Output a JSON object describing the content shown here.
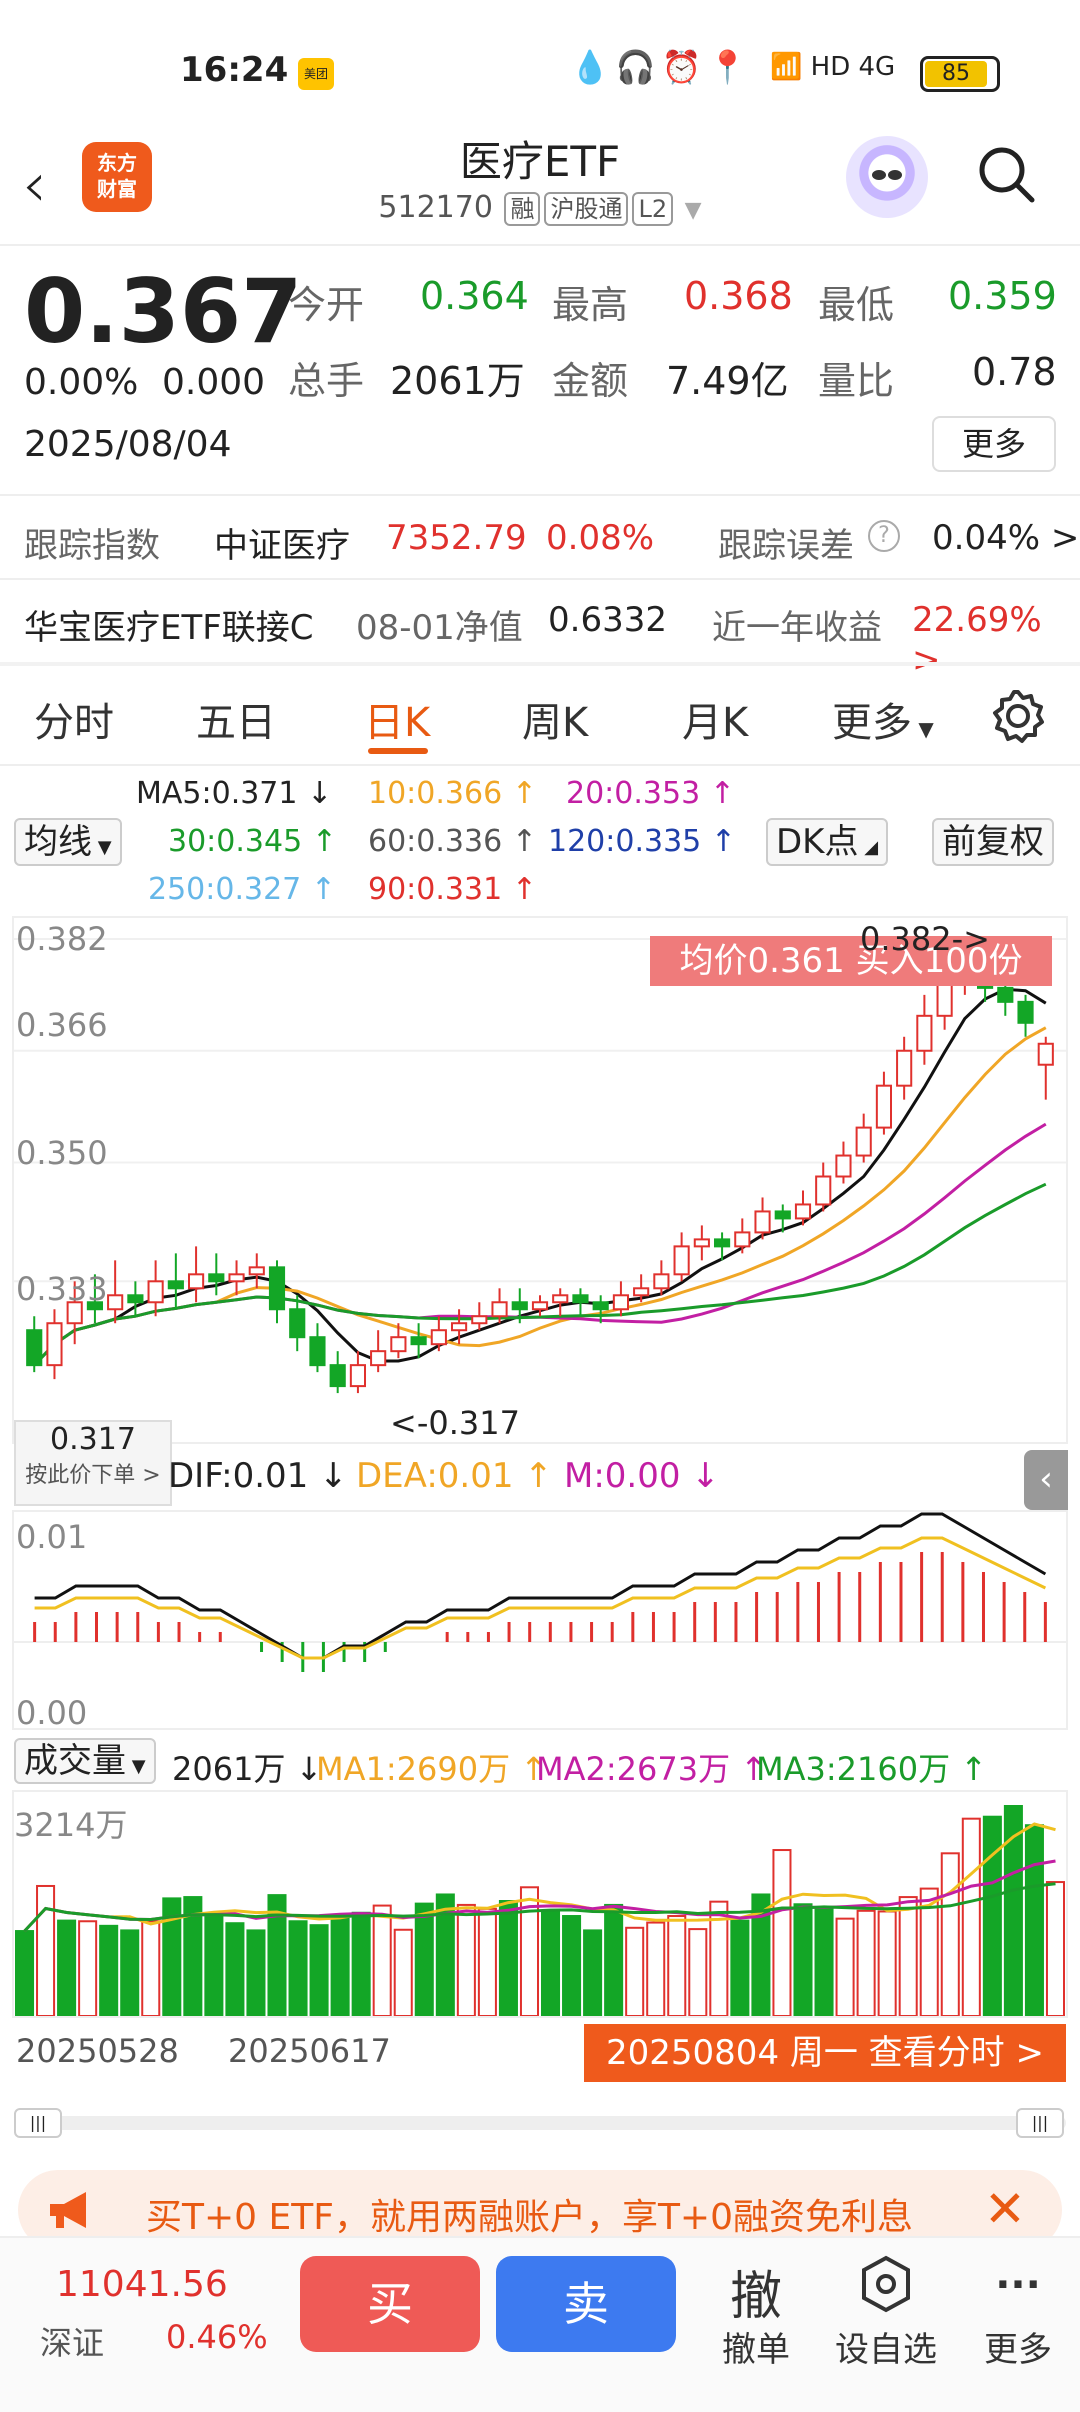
{
  "status_bar": {
    "time": "16:24",
    "meituan": "美团",
    "battery": "85"
  },
  "header": {
    "title": "医疗ETF",
    "code": "512170",
    "tags": [
      "融",
      "沪股通",
      "L2"
    ],
    "logo_line1": "东方",
    "logo_line2": "财富"
  },
  "quote": {
    "price": "0.367",
    "change_pct": "0.00%",
    "change": "0.000",
    "date": "2025/08/04",
    "open_label": "今开",
    "open": "0.364",
    "high_label": "最高",
    "high": "0.368",
    "low_label": "最低",
    "low": "0.359",
    "volume_label": "总手",
    "volume": "2061万",
    "amount_label": "金额",
    "amount": "7.49亿",
    "ratio_label": "量比",
    "ratio": "0.78",
    "more_label": "更多"
  },
  "tracking": {
    "label": "跟踪指数",
    "index_name": "中证医疗",
    "index_value": "7352.79",
    "index_change": "0.08%",
    "error_label": "跟踪误差",
    "error_value": "0.04% >"
  },
  "linked_fund": {
    "name": "华宝医疗ETF联接C",
    "nav_label": "08-01净值",
    "nav": "0.6332",
    "return_label": "近一年收益",
    "return_value": "22.69% >"
  },
  "tabs": [
    "分时",
    "五日",
    "日K",
    "周K",
    "月K",
    "更多"
  ],
  "active_tab": "日K",
  "ma_legend": {
    "selector": "均线",
    "ma5": "MA5:0.371 ↓",
    "ma10": "10:0.366 ↑",
    "ma20": "20:0.353 ↑",
    "ma30": "30:0.345 ↑",
    "ma60": "60:0.336 ↑",
    "ma120": "120:0.335 ↑",
    "ma250": "250:0.327 ↑",
    "ma90": "90:0.331 ↑",
    "dk_label": "DK点",
    "adjust_label": "前复权"
  },
  "kchart": {
    "y_labels": [
      "0.382",
      "0.366",
      "0.350",
      "0.333"
    ],
    "banner": "均价0.361  买入100份",
    "high_marker": "0.382->",
    "low_marker": "<-0.317",
    "price_tag": "0.317",
    "price_tag_sub": "按此价下单 >"
  },
  "macd": {
    "dif": "DIF:0.01 ↓",
    "dea": "DEA:0.01 ↑",
    "m": "M:0.00 ↓",
    "y_top": "0.01",
    "y_bottom": "0.00"
  },
  "volume_panel": {
    "selector": "成交量",
    "vol": "2061万 ↓",
    "ma1": "MA1:2690万 ↑",
    "ma2": "MA2:2673万 ↑",
    "ma3": "MA3:2160万 ↑",
    "y_top": "3214万"
  },
  "x_axis": {
    "d1": "20250528",
    "d2": "20250617",
    "current": "20250804 周一 查看分时 >"
  },
  "promo": {
    "text": "买T+0 ETF，就用两融账户，享T+0融资免利息"
  },
  "bottom_bar": {
    "index_value": "11041.56",
    "index_name": "深证",
    "index_change": "0.46%",
    "buy": "买",
    "sell": "卖",
    "cancel_icon": "撤",
    "cancel": "撤单",
    "watch": "设自选",
    "more": "更多"
  },
  "chart_data": {
    "type": "candlestick",
    "y_range": [
      0.31,
      0.385
    ],
    "candles": [
      {
        "o": 0.326,
        "c": 0.321,
        "h": 0.328,
        "l": 0.32
      },
      {
        "o": 0.321,
        "c": 0.327,
        "h": 0.329,
        "l": 0.319
      },
      {
        "o": 0.327,
        "c": 0.33,
        "h": 0.333,
        "l": 0.324
      },
      {
        "o": 0.33,
        "c": 0.329,
        "h": 0.334,
        "l": 0.327
      },
      {
        "o": 0.329,
        "c": 0.331,
        "h": 0.336,
        "l": 0.327
      },
      {
        "o": 0.331,
        "c": 0.33,
        "h": 0.333,
        "l": 0.328
      },
      {
        "o": 0.33,
        "c": 0.333,
        "h": 0.336,
        "l": 0.328
      },
      {
        "o": 0.333,
        "c": 0.332,
        "h": 0.337,
        "l": 0.329
      },
      {
        "o": 0.332,
        "c": 0.334,
        "h": 0.338,
        "l": 0.33
      },
      {
        "o": 0.334,
        "c": 0.333,
        "h": 0.337,
        "l": 0.331
      },
      {
        "o": 0.333,
        "c": 0.334,
        "h": 0.336,
        "l": 0.331
      },
      {
        "o": 0.334,
        "c": 0.335,
        "h": 0.337,
        "l": 0.332
      },
      {
        "o": 0.335,
        "c": 0.329,
        "h": 0.336,
        "l": 0.327
      },
      {
        "o": 0.329,
        "c": 0.325,
        "h": 0.331,
        "l": 0.323
      },
      {
        "o": 0.325,
        "c": 0.321,
        "h": 0.327,
        "l": 0.32
      },
      {
        "o": 0.321,
        "c": 0.318,
        "h": 0.323,
        "l": 0.317
      },
      {
        "o": 0.318,
        "c": 0.321,
        "h": 0.323,
        "l": 0.317
      },
      {
        "o": 0.321,
        "c": 0.323,
        "h": 0.326,
        "l": 0.32
      },
      {
        "o": 0.323,
        "c": 0.325,
        "h": 0.327,
        "l": 0.322
      },
      {
        "o": 0.325,
        "c": 0.324,
        "h": 0.327,
        "l": 0.322
      },
      {
        "o": 0.324,
        "c": 0.326,
        "h": 0.328,
        "l": 0.323
      },
      {
        "o": 0.326,
        "c": 0.327,
        "h": 0.329,
        "l": 0.324
      },
      {
        "o": 0.327,
        "c": 0.328,
        "h": 0.33,
        "l": 0.326
      },
      {
        "o": 0.328,
        "c": 0.33,
        "h": 0.332,
        "l": 0.327
      },
      {
        "o": 0.33,
        "c": 0.329,
        "h": 0.332,
        "l": 0.327
      },
      {
        "o": 0.329,
        "c": 0.33,
        "h": 0.331,
        "l": 0.328
      },
      {
        "o": 0.33,
        "c": 0.331,
        "h": 0.332,
        "l": 0.328
      },
      {
        "o": 0.331,
        "c": 0.33,
        "h": 0.332,
        "l": 0.328
      },
      {
        "o": 0.33,
        "c": 0.329,
        "h": 0.331,
        "l": 0.327
      },
      {
        "o": 0.329,
        "c": 0.331,
        "h": 0.333,
        "l": 0.328
      },
      {
        "o": 0.331,
        "c": 0.332,
        "h": 0.334,
        "l": 0.33
      },
      {
        "o": 0.332,
        "c": 0.334,
        "h": 0.336,
        "l": 0.331
      },
      {
        "o": 0.334,
        "c": 0.338,
        "h": 0.34,
        "l": 0.333
      },
      {
        "o": 0.338,
        "c": 0.339,
        "h": 0.341,
        "l": 0.336
      },
      {
        "o": 0.339,
        "c": 0.338,
        "h": 0.34,
        "l": 0.336
      },
      {
        "o": 0.338,
        "c": 0.34,
        "h": 0.342,
        "l": 0.337
      },
      {
        "o": 0.34,
        "c": 0.343,
        "h": 0.345,
        "l": 0.339
      },
      {
        "o": 0.343,
        "c": 0.342,
        "h": 0.344,
        "l": 0.34
      },
      {
        "o": 0.342,
        "c": 0.344,
        "h": 0.346,
        "l": 0.341
      },
      {
        "o": 0.344,
        "c": 0.348,
        "h": 0.35,
        "l": 0.343
      },
      {
        "o": 0.348,
        "c": 0.351,
        "h": 0.353,
        "l": 0.347
      },
      {
        "o": 0.351,
        "c": 0.355,
        "h": 0.357,
        "l": 0.35
      },
      {
        "o": 0.355,
        "c": 0.361,
        "h": 0.363,
        "l": 0.354
      },
      {
        "o": 0.361,
        "c": 0.366,
        "h": 0.368,
        "l": 0.359
      },
      {
        "o": 0.366,
        "c": 0.371,
        "h": 0.374,
        "l": 0.364
      },
      {
        "o": 0.371,
        "c": 0.376,
        "h": 0.379,
        "l": 0.369
      },
      {
        "o": 0.376,
        "c": 0.379,
        "h": 0.382,
        "l": 0.374
      },
      {
        "o": 0.379,
        "c": 0.375,
        "h": 0.381,
        "l": 0.373
      },
      {
        "o": 0.375,
        "c": 0.373,
        "h": 0.377,
        "l": 0.371
      },
      {
        "o": 0.373,
        "c": 0.37,
        "h": 0.374,
        "l": 0.368
      },
      {
        "o": 0.364,
        "c": 0.367,
        "h": 0.368,
        "l": 0.359
      }
    ],
    "macd_values": [
      0.002,
      0.002,
      0.003,
      0.003,
      0.003,
      0.003,
      0.002,
      0.002,
      0.001,
      0.001,
      0.0,
      -0.001,
      -0.002,
      -0.003,
      -0.003,
      -0.002,
      -0.002,
      -0.001,
      0.0,
      0.0,
      0.001,
      0.001,
      0.001,
      0.002,
      0.002,
      0.002,
      0.002,
      0.002,
      0.002,
      0.003,
      0.003,
      0.003,
      0.004,
      0.004,
      0.004,
      0.005,
      0.005,
      0.006,
      0.006,
      0.007,
      0.007,
      0.008,
      0.008,
      0.009,
      0.009,
      0.008,
      0.007,
      0.006,
      0.005,
      0.004
    ],
    "volumes": [
      1300,
      1990,
      1460,
      1450,
      1380,
      1310,
      1450,
      1800,
      1820,
      1560,
      1420,
      1310,
      1850,
      1450,
      1390,
      1510,
      1580,
      1690,
      1320,
      1720,
      1860,
      1700,
      1640,
      1760,
      1970,
      1610,
      1530,
      1310,
      1700,
      1350,
      1430,
      1530,
      1330,
      1750,
      1460,
      1860,
      2540,
      1710,
      1650,
      1490,
      1610,
      1600,
      1820,
      1950,
      2490,
      3020,
      3050,
      3214,
      2920,
      2050
    ],
    "vol_up": [
      false,
      true,
      false,
      true,
      false,
      false,
      true,
      false,
      false,
      false,
      false,
      false,
      false,
      false,
      false,
      false,
      false,
      true,
      true,
      false,
      false,
      true,
      true,
      false,
      true,
      false,
      false,
      false,
      false,
      true,
      true,
      true,
      true,
      true,
      false,
      false,
      true,
      false,
      false,
      true,
      true,
      true,
      true,
      true,
      true,
      true,
      false,
      false,
      false,
      true
    ]
  }
}
